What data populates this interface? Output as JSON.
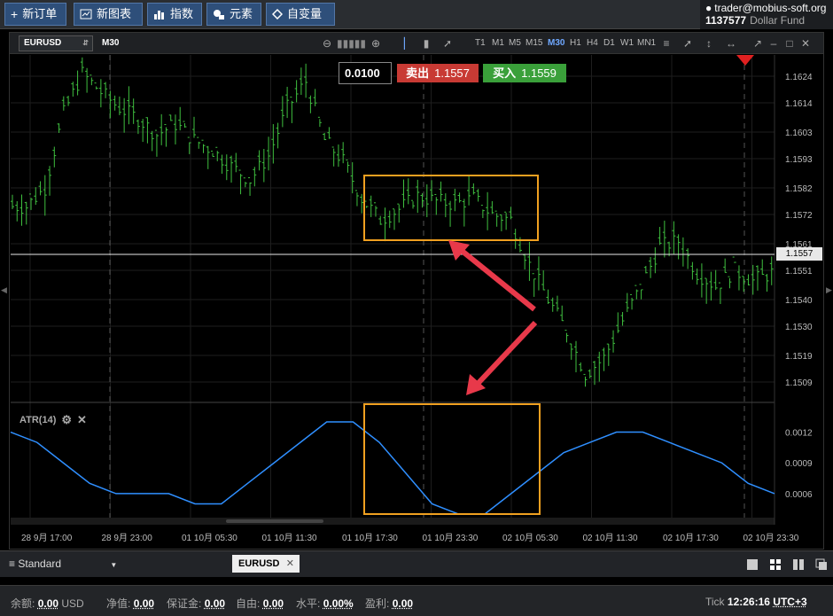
{
  "toolbar": {
    "new_order": "新订单",
    "new_chart": "新图表",
    "indicators": "指数",
    "elements": "元素",
    "variables": "自变量"
  },
  "account": {
    "user": "trader@mobius-soft.org",
    "number": "1137577",
    "fund": "Dollar Fund"
  },
  "chart": {
    "symbol": "EURUSD",
    "timeframe_label": "M30",
    "timeframes": [
      "T1",
      "M1",
      "M5",
      "M15",
      "M30",
      "H1",
      "H4",
      "D1",
      "W1",
      "MN1"
    ],
    "active_timeframe": "M30",
    "lot": "0.0100",
    "sell_label": "卖出",
    "sell_price": "1.1557",
    "buy_label": "买入",
    "buy_price": "1.1559",
    "current_price": "1.1557",
    "price_ticks": [
      "1.1624",
      "1.1614",
      "1.1603",
      "1.1593",
      "1.1582",
      "1.1572",
      "1.1561",
      "1.1551",
      "1.1540",
      "1.1530",
      "1.1519",
      "1.1509"
    ],
    "atr_label": "ATR(14)",
    "atr_ticks": [
      "0.0012",
      "0.0009",
      "0.0006"
    ],
    "time_ticks": [
      "28 9月 17:00",
      "28 9月 23:00",
      "01 10月 05:30",
      "01 10月 11:30",
      "01 10月 17:30",
      "01 10月 23:30",
      "02 10月 05:30",
      "02 10月 11:30",
      "02 10月 17:30",
      "02 10月 23:30"
    ],
    "colors": {
      "candle": "#3fbf3f",
      "atr": "#2f8fff",
      "highlight": "#f0a020",
      "arrow": "#e8394a",
      "sell": "#c83a34",
      "buy": "#3aa03a"
    }
  },
  "chart_data": {
    "type": "line",
    "title": "",
    "series": [
      {
        "name": "",
        "values": [
          1.1575,
          1.1582,
          1.161,
          1.1625,
          1.1618,
          1.1612,
          1.1608,
          1.1602,
          1.1606,
          1.16,
          1.1596,
          1.159,
          1.1585,
          1.1594,
          1.1612,
          1.1622,
          1.16,
          1.1592,
          1.1578,
          1.157,
          1.1574,
          1.1579,
          1.1577,
          1.1576,
          1.1578,
          1.1572,
          1.157,
          1.1553,
          1.154,
          1.1528,
          1.1512,
          1.1518,
          1.1532,
          1.1545,
          1.156,
          1.1562,
          1.155,
          1.1545,
          1.1551,
          1.1547,
          1.155
        ]
      },
      {
        "name": "ATR(14)",
        "values": [
          0.0012,
          0.0011,
          0.0009,
          0.0007,
          0.0006,
          0.0006,
          0.0006,
          0.0005,
          0.0005,
          0.0007,
          0.0009,
          0.0011,
          0.0013,
          0.0013,
          0.0011,
          0.0008,
          0.0005,
          0.0004,
          0.0004,
          0.0006,
          0.0008,
          0.001,
          0.0011,
          0.0012,
          0.0012,
          0.0011,
          0.001,
          0.0009,
          0.0007,
          0.0006
        ]
      }
    ],
    "ylim": [
      1.1502,
      1.1632
    ],
    "grid": true
  },
  "tabs": {
    "layout_name": "Standard",
    "symbol_tab": "EURUSD"
  },
  "status": {
    "balance_label": "余额:",
    "balance": "0.00",
    "currency": "USD",
    "equity_label": "净值:",
    "equity": "0.00",
    "margin_label": "保证金:",
    "margin": "0.00",
    "free_label": "自由:",
    "free": "0.00",
    "level_label": "水平:",
    "level": "0.00%",
    "profit_label": "盈利:",
    "profit": "0.00",
    "tick_label": "Tick",
    "time": "12:26:16",
    "timezone": "UTC+3"
  }
}
